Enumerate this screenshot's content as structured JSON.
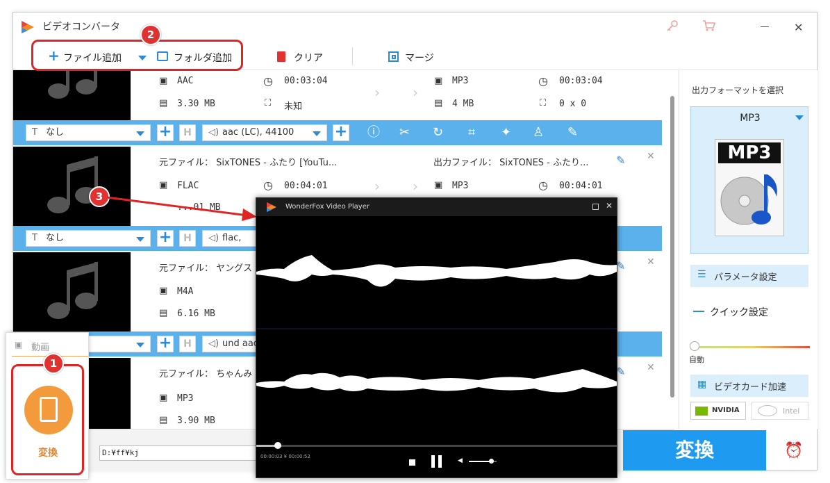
{
  "app": {
    "title": "ビデオコンバータ",
    "accent": "#2a8ad8",
    "bar_color": "#5ab1ec",
    "convert_color": "#1e9bf0"
  },
  "toolbar": {
    "add_file": "ファイル追加",
    "add_folder": "フォルダ追加",
    "clear": "クリア",
    "merge": "マージ"
  },
  "rows": [
    {
      "src_format": "AAC",
      "src_duration": "00:03:04",
      "src_size": "3.30 MB",
      "src_res": "未知",
      "out_format": "MP3",
      "out_duration": "00:03:04",
      "out_size": "4 MB",
      "out_res": "0 x 0",
      "subtitle": "なし",
      "audio": "aac (LC), 44100"
    },
    {
      "src_name": "元ファイル： SixTONES - ふたり [YouTu...",
      "out_name": "出力ファイル： SixTONES - ふたり...",
      "src_format": "FLAC",
      "src_duration": "00:04:01",
      "src_size": "...01 MB",
      "out_format": "MP3",
      "out_duration": "00:04:01",
      "subtitle": "なし",
      "audio": "flac,"
    },
    {
      "src_name": "元ファイル： ヤングス",
      "src_format": "M4A",
      "src_size": "6.16 MB",
      "audio": "und aac"
    },
    {
      "src_name": "元ファイル： ちゃんみ",
      "src_format": "MP3",
      "src_size": "3.90 MB"
    }
  ],
  "bottom": {
    "output_path": "D:¥ff¥kj"
  },
  "right_panel": {
    "heading": "出力フォーマットを選択",
    "format": "MP3",
    "param_settings": "パラメータ設定",
    "quick_settings": "クイック設定",
    "auto_label": "自動",
    "gpu_accel": "ビデオカード加速",
    "nvidia": "NVIDIA",
    "intel": "Intel",
    "convert": "変換"
  },
  "left_popup": {
    "video_tab": "動画",
    "convert_label": "変換"
  },
  "player": {
    "title": "WonderFox Video Player",
    "time": "00:00:03 ¥ 00:00:52",
    "progress": 0.06,
    "volume": 0.8
  },
  "annotations": {
    "badge1": "1",
    "badge2": "2",
    "badge3": "3"
  }
}
